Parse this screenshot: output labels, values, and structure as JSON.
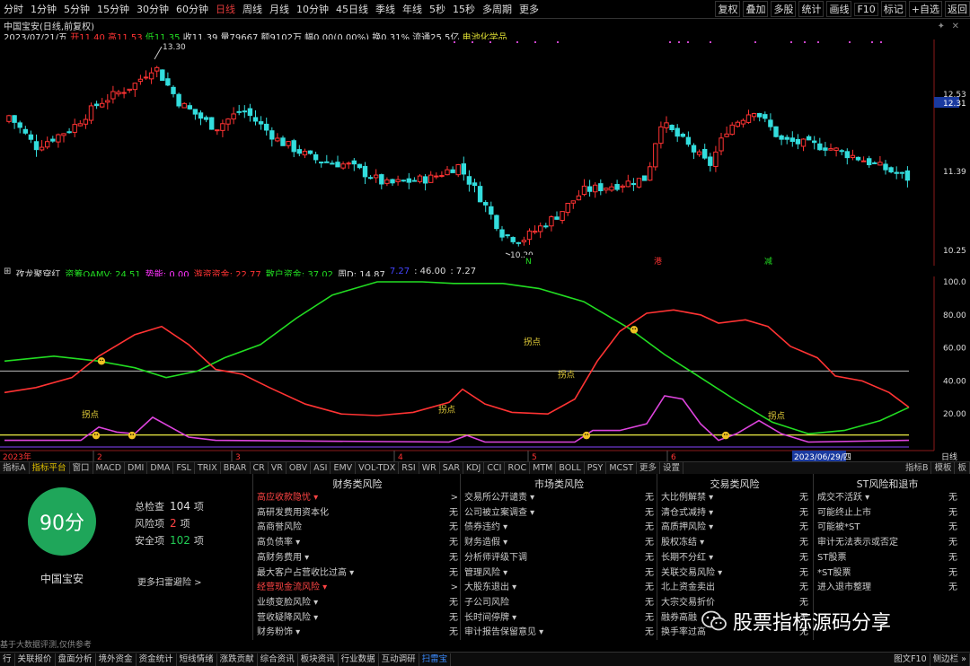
{
  "toolbar": {
    "periods": [
      "分时",
      "1分钟",
      "5分钟",
      "15分钟",
      "30分钟",
      "60分钟",
      "日线",
      "周线",
      "月线",
      "10分钟",
      "45日线",
      "季线",
      "年线",
      "5秒",
      "15秒",
      "多周期",
      "更多"
    ],
    "active_period": "日线",
    "right_buttons": [
      "复权",
      "叠加",
      "多股",
      "统计",
      "画线",
      "F10",
      "标记",
      "+自选",
      "返回"
    ]
  },
  "stock_info": {
    "title": "中国宝安(日线,前复权)",
    "date": "2023/07/21/五",
    "open_label": "开",
    "open": "11.40",
    "high_label": "高",
    "high": "11.53",
    "low_label": "低",
    "low": "11.35",
    "close_label": "收",
    "close": "11.39",
    "volume_label": "量",
    "volume": "79667",
    "amount": "额9102万",
    "change": "幅0.00(0.00%)",
    "turnover": "换0.31%",
    "float_cap": "流通25.5亿",
    "sector": "电池化学品"
  },
  "price_axis": {
    "labels": [
      "12.53",
      "12.31",
      "11.39",
      "10.25"
    ],
    "current": "12.31",
    "high_mark": "13.30",
    "low_mark": "10.20"
  },
  "event_marks": [
    "N",
    "港",
    "减"
  ],
  "indicator": {
    "name": "孜龙聚穿红",
    "values": [
      {
        "label": "资筹OAMV: 24.51",
        "color": "#22dd22"
      },
      {
        "label": "势能: 0.00",
        "color": "#ff33ff"
      },
      {
        "label": "游资资金: 22.77",
        "color": "#ff3333"
      },
      {
        "label": "散户资金: 37.02",
        "color": "#22dd22"
      },
      {
        "label": "周D: 14.87",
        "color": "#dddddd"
      },
      {
        "label": "7.27",
        "color": "#4444ff"
      },
      {
        "label": ": 46.00",
        "color": "#dddddd"
      },
      {
        "label": ": 7.27",
        "color": "#dddddd"
      }
    ],
    "axis": [
      "100.0",
      "80.00",
      "60.00",
      "40.00",
      "20.00"
    ],
    "annotations": [
      "拐点",
      "拐点",
      "拐点",
      "拐点",
      "拐点"
    ]
  },
  "time_axis": {
    "year": "2023年",
    "months": [
      "2",
      "3",
      "4",
      "5",
      "6"
    ],
    "cursor_date": "2023/06/29/四",
    "right_label": "日线"
  },
  "indicator_tabs": [
    "指标A",
    "指标平台",
    "窗口",
    "MACD",
    "DMI",
    "DMA",
    "FSL",
    "TRIX",
    "BRAR",
    "CR",
    "VR",
    "OBV",
    "ASI",
    "EMV",
    "VOL-TDX",
    "RSI",
    "WR",
    "SAR",
    "KDJ",
    "CCI",
    "ROC",
    "MTM",
    "BOLL",
    "PSY",
    "MCST",
    "更多",
    "设置"
  ],
  "indicator_tabs_right": [
    "指标B",
    "模板",
    "板"
  ],
  "risk": {
    "score": "90分",
    "stock_name": "中国宝安",
    "stats": [
      {
        "label": "总检查",
        "value": "104",
        "unit": "项",
        "color": "#dddddd"
      },
      {
        "label": "风险项",
        "value": "2",
        "unit": "项",
        "color": "#ff4444"
      },
      {
        "label": "安全项",
        "value": "102",
        "unit": "项",
        "color": "#22cc55"
      }
    ],
    "more_link": "更多扫雷避险 >",
    "disclaimer": "基于大数据评测,仅供参考",
    "columns": [
      {
        "title": "财务类风险",
        "rows": [
          {
            "name": "高应收款隐忧 ▾",
            "value": ">",
            "red": true
          },
          {
            "name": "高研发费用资本化",
            "value": "无"
          },
          {
            "name": "高商誉风险",
            "value": "无"
          },
          {
            "name": "高负债率 ▾",
            "value": "无"
          },
          {
            "name": "高财务费用 ▾",
            "value": "无"
          },
          {
            "name": "最大客户占营收比过高 ▾",
            "value": "无"
          },
          {
            "name": "经营现金流风险 ▾",
            "value": ">",
            "red": true
          },
          {
            "name": "业绩变脸风险 ▾",
            "value": "无"
          },
          {
            "name": "营收疑降风险 ▾",
            "value": "无"
          },
          {
            "name": "财务粉饰 ▾",
            "value": "无"
          }
        ]
      },
      {
        "title": "市场类风险",
        "rows": [
          {
            "name": "交易所公开谴责 ▾",
            "value": "无"
          },
          {
            "name": "公司被立案调查 ▾",
            "value": "无"
          },
          {
            "name": "债券违约 ▾",
            "value": "无"
          },
          {
            "name": "财务造假 ▾",
            "value": "无"
          },
          {
            "name": "分析师评级下调",
            "value": "无"
          },
          {
            "name": "管理风险 ▾",
            "value": "无"
          },
          {
            "name": "大股东退出 ▾",
            "value": "无"
          },
          {
            "name": "子公司风险",
            "value": "无"
          },
          {
            "name": "长时间停牌 ▾",
            "value": "无"
          },
          {
            "name": "审计报告保留意见 ▾",
            "value": "无"
          }
        ]
      },
      {
        "title": "交易类风险",
        "rows": [
          {
            "name": "大比例解禁 ▾",
            "value": "无"
          },
          {
            "name": "清仓式减持 ▾",
            "value": "无"
          },
          {
            "name": "高质押风险 ▾",
            "value": "无"
          },
          {
            "name": "股权冻结 ▾",
            "value": "无"
          },
          {
            "name": "长期不分红 ▾",
            "value": "无"
          },
          {
            "name": "关联交易风险 ▾",
            "value": "无"
          },
          {
            "name": "北上资金卖出",
            "value": "无"
          },
          {
            "name": "大宗交易折价",
            "value": "无"
          },
          {
            "name": "融券高融",
            "value": "无"
          },
          {
            "name": "换手率过高",
            "value": "无"
          }
        ]
      },
      {
        "title": "ST风险和退市",
        "rows": [
          {
            "name": "成交不活跃 ▾",
            "value": "无"
          },
          {
            "name": "可能终止上市",
            "value": "无"
          },
          {
            "name": "可能被*ST",
            "value": "无"
          },
          {
            "name": "审计无法表示或否定",
            "value": "无"
          },
          {
            "name": "ST股票",
            "value": "无"
          },
          {
            "name": "*ST股票",
            "value": "无"
          },
          {
            "name": "进入退市整理",
            "value": "无"
          }
        ]
      }
    ],
    "watermark": "股票指标源码分享"
  },
  "bottom_tabs": [
    "行",
    "关联报价",
    "盘面分析",
    "境外资金",
    "资金统计",
    "短线情绪",
    "涨跌贡献",
    "综合资讯",
    "板块资讯",
    "行业数据",
    "互动调研",
    "扫雷宝"
  ],
  "bottom_active": "扫雷宝",
  "bottom_right": [
    "图文F10",
    "侧边栏 »"
  ],
  "colors": {
    "up": "#ff3333",
    "down": "#33dddd",
    "green": "#22dd22",
    "magenta": "#dd44dd",
    "yellow": "#eeee44",
    "score": "#1fa65a"
  }
}
